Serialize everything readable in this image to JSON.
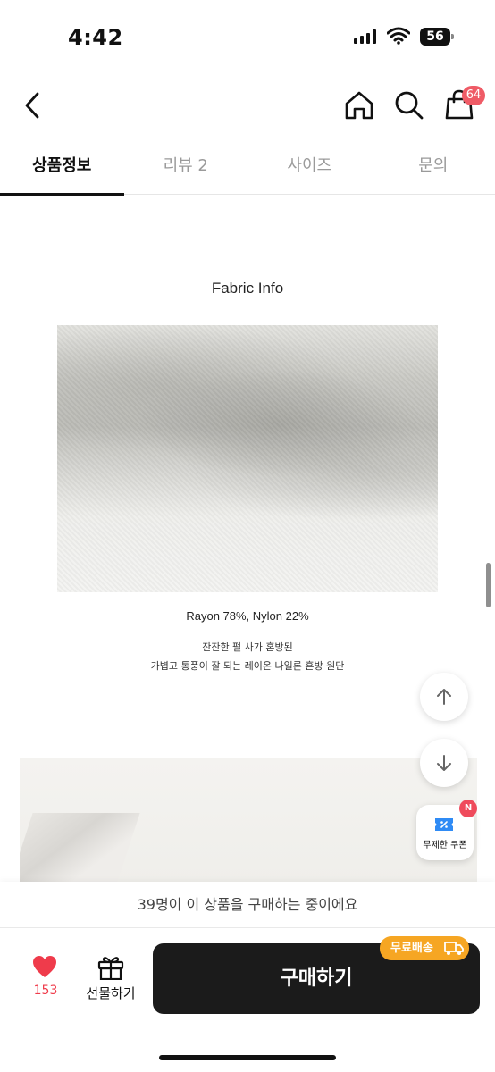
{
  "status_bar": {
    "time": "4:42",
    "battery_level": "56"
  },
  "header": {
    "cart_count": "64",
    "icons": [
      "back-icon",
      "home-icon",
      "search-icon",
      "shopping-bag-icon"
    ]
  },
  "tabs": [
    {
      "label": "상품정보",
      "active": true
    },
    {
      "label": "리뷰 2",
      "active": false
    },
    {
      "label": "사이즈",
      "active": false
    },
    {
      "label": "문의",
      "active": false
    }
  ],
  "content": {
    "fabric_title": "Fabric Info",
    "composition": "Rayon 78%, Nylon 22%",
    "description_line1": "잔잔한 펄 사가 혼방된",
    "description_line2": "가볍고 통풍이 잘 되는 레이온 나일론 혼방 원단"
  },
  "floating": {
    "coupon_label": "무제한 쿠폰",
    "coupon_badge": "N",
    "icons": [
      "arrow-up-icon",
      "arrow-down-icon",
      "coupon-icon"
    ]
  },
  "bottom": {
    "buyers_notice": "39명이 이 상품을 구매하는 중이에요",
    "like_count": "153",
    "gift_label": "선물하기",
    "buy_label": "구매하기",
    "free_shipping_label": "무료배송",
    "icons": [
      "heart-icon",
      "gift-icon",
      "truck-icon"
    ]
  },
  "colors": {
    "accent_red": "#ef5b66",
    "buy_button": "#1b1b1b",
    "free_shipping": "#f6a623",
    "like_red": "#ef3b4b"
  }
}
